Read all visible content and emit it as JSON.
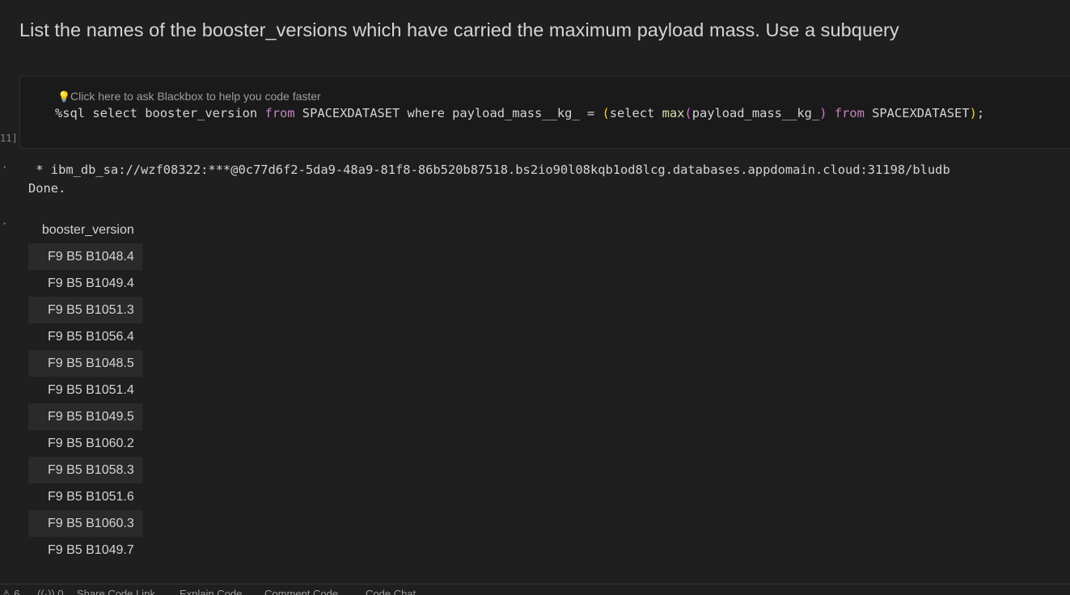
{
  "markdown": {
    "heading": "List the names of the booster_versions which have carried the maximum payload mass. Use a subquery"
  },
  "code_cell": {
    "hint": "Click here to ask Blackbox to help you code faster",
    "execution_count": "11]",
    "code_tokens": {
      "t1": "%sql select booster_version ",
      "t2": "from",
      "t3": " SPACEXDATASET where payload_mass__kg_ = ",
      "t4": "(",
      "t5": "select ",
      "t6": "max",
      "t7": "(",
      "t8": "payload_mass__kg_",
      "t9": ")",
      "t10": " ",
      "t11": "from",
      "t12": " SPACEXDATASET",
      "t13": ")",
      "t14": ";"
    }
  },
  "output": {
    "connection_line": " * ibm_db_sa://wzf08322:***@0c77d6f2-5da9-48a9-81f8-86b520b87518.bs2io90l08kqb1od8lcg.databases.appdomain.cloud:31198/bludb",
    "done_line": "Done.",
    "table": {
      "header": "booster_version",
      "rows": [
        "F9 B5 B1048.4",
        "F9 B5 B1049.4",
        "F9 B5 B1051.3",
        "F9 B5 B1056.4",
        "F9 B5 B1048.5",
        "F9 B5 B1051.4",
        "F9 B5 B1049.5",
        "F9 B5 B1060.2",
        "F9 B5 B1058.3",
        "F9 B5 B1051.6",
        "F9 B5 B1060.3",
        "F9 B5 B1049.7"
      ]
    }
  },
  "status_bar": {
    "warning_count": "6",
    "broadcast_count": "0",
    "items": [
      "Share Code Link",
      "Explain Code",
      "Comment Code",
      "Code Chat"
    ]
  },
  "icons": {
    "bulb": "lightbulb-icon",
    "warning": "warning-icon",
    "broadcast": "broadcast-icon"
  }
}
